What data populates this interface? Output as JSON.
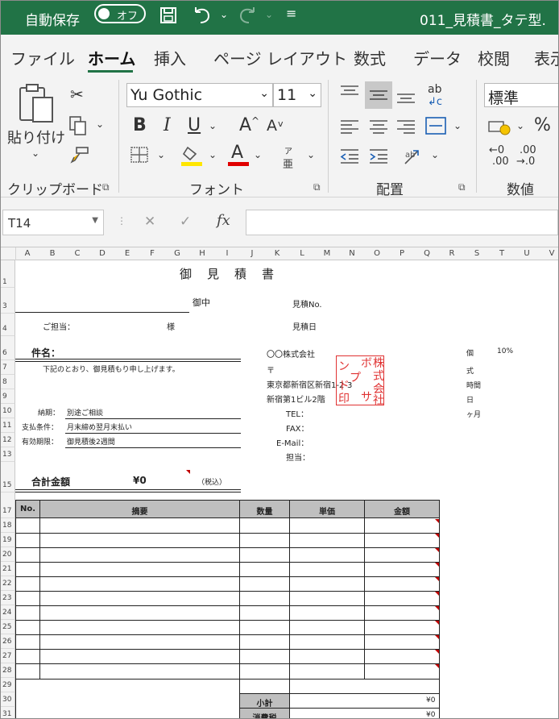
{
  "titlebar": {
    "autosave": "自動保存",
    "toggle": "オフ",
    "filename": "011_見積書_タテ型."
  },
  "tabs": [
    "ファイル",
    "ホーム",
    "挿入",
    "ページ レイアウト",
    "数式",
    "データ",
    "校閲",
    "表示"
  ],
  "ribbon": {
    "paste_label": "貼り付け",
    "clipboard_group": "クリップボード",
    "font_name": "Yu Gothic",
    "font_size": "11",
    "font_group": "フォント",
    "align_group": "配置",
    "number_format": "標準",
    "number_group": "数値",
    "bold": "B",
    "italic": "I",
    "underline": "U",
    "font_color_glyph": "A",
    "inc_font": "A",
    "dec_font": "A",
    "phonetic_top": "ア",
    "phonetic_bottom": "亜",
    "wrap": "ab",
    "inc_dec": "←0",
    "inc_dec2": ".00",
    "dec_dec": ".00",
    "dec_dec2": "→.0",
    "percent": "%"
  },
  "formula_bar": {
    "cell_ref": "T14",
    "fx": "fx",
    "value": ""
  },
  "columns": [
    "A",
    "B",
    "C",
    "D",
    "E",
    "F",
    "G",
    "H",
    "I",
    "J",
    "K",
    "L",
    "M",
    "N",
    "O",
    "P",
    "Q",
    "R",
    "S",
    "T",
    "U",
    "V"
  ],
  "rows": [
    "1",
    "3",
    "4",
    "6",
    "7",
    "8",
    "9",
    "10",
    "11",
    "12",
    "13",
    "15",
    "17",
    "18",
    "19",
    "20",
    "21",
    "22",
    "23",
    "24",
    "25",
    "26",
    "27",
    "28",
    "29",
    "30",
    "31"
  ],
  "doc": {
    "title": "御　見　積　書",
    "onchu": "御中",
    "estimate_no": "見積No.",
    "estimate_date": "見積日",
    "tanto": "ご担当：",
    "sama": "様",
    "kenmei": "件名：",
    "intro": "下記のとおり、御見積もり申し上げます。",
    "company": "〇〇株式会社",
    "postal": "〒",
    "address1": "東京都新宿区新宿1-2-3",
    "address2": "新宿第1ビル2階",
    "tel": "TEL：",
    "fax": "FAX：",
    "email": "E-Mail：",
    "tanto2": "担当：",
    "nouki_label": "納期：",
    "nouki_value": "別途ご相談",
    "shiharai_label": "支払条件：",
    "shiharai_value": "月末締め翌月末払い",
    "yuko_label": "有効期限：",
    "yuko_value": "御見積後2週間",
    "total_label": "合計金額",
    "total_value": "¥0",
    "zeikomi": "（税込）",
    "stamp": [
      "ボ",
      "株",
      "ン",
      "式",
      "プ",
      "会",
      "ド",
      "サ",
      "印",
      "社"
    ],
    "side_unit": "個",
    "side_pct": "10%",
    "side_shiki": "式",
    "side_jikan": "時間",
    "side_nichi": "日",
    "side_kagetsu": "ヶ月"
  },
  "table": {
    "headers": [
      "No.",
      "摘要",
      "数量",
      "単価",
      "金額"
    ],
    "subtotal_label": "小計",
    "subtotal_value": "¥0",
    "tax_label": "消費税",
    "tax_value": "¥0"
  }
}
